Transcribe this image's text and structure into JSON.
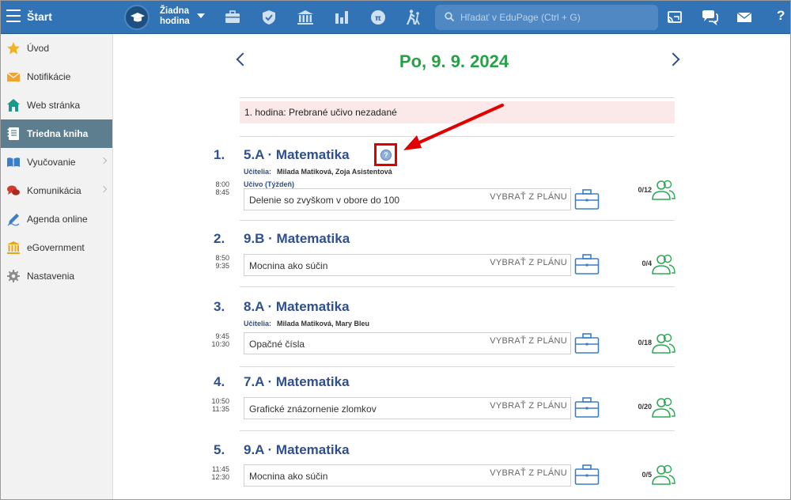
{
  "topbar": {
    "app_title": "Štart",
    "period_label_line1": "Žiadna",
    "period_label_line2": "hodina",
    "search_placeholder": "Hľadať v EduPage (Ctrl + G)",
    "help_label": "?",
    "icons": [
      "briefcase-icon",
      "shield-icon",
      "bank-icon",
      "bar-chart-icon",
      "pi-circle-icon",
      "hiking-icon",
      "cast-icon",
      "chat-icon",
      "mail-icon",
      "help-icon"
    ]
  },
  "sidebar": {
    "items": [
      {
        "label": "Úvod",
        "icon": "star-icon",
        "has_submenu": false,
        "active": false
      },
      {
        "label": "Notifikácie",
        "icon": "envelope-icon",
        "has_submenu": false,
        "active": false
      },
      {
        "label": "Web stránka",
        "icon": "house-icon",
        "has_submenu": false,
        "active": false
      },
      {
        "label": "Triedna kniha",
        "icon": "notebook-icon",
        "has_submenu": false,
        "active": true
      },
      {
        "label": "Vyučovanie",
        "icon": "open-book-icon",
        "has_submenu": true,
        "active": false
      },
      {
        "label": "Komunikácia",
        "icon": "speech-bubbles-icon",
        "has_submenu": true,
        "active": false
      },
      {
        "label": "Agenda online",
        "icon": "pencil-icon",
        "has_submenu": false,
        "active": false
      },
      {
        "label": "eGovernment",
        "icon": "bank-icon",
        "has_submenu": false,
        "active": false
      },
      {
        "label": "Nastavenia",
        "icon": "gear-icon",
        "has_submenu": false,
        "active": false
      }
    ]
  },
  "main": {
    "date": "Po, 9. 9. 2024",
    "notice": "1. hodina: Prebrané učivo nezadané",
    "help_marker": "?",
    "plan_label": "VYBRAŤ Z PLÁNU",
    "lessons": [
      {
        "num": "1.",
        "title": "5.A · Matematika",
        "teachers_label": "Učitelia:",
        "teachers": "Milada Matiková, Zoja Asistentová",
        "curriculum": "Učivo (Týždeň)",
        "start": "8:00",
        "end": "8:45",
        "topic": "Delenie so zvyškom v obore do 100",
        "count": "0/12"
      },
      {
        "num": "2.",
        "title": "9.B · Matematika",
        "start": "8:50",
        "end": "9:35",
        "topic": "Mocnina ako súčin",
        "count": "0/4"
      },
      {
        "num": "3.",
        "title": "8.A · Matematika",
        "teachers_label": "Učitelia:",
        "teachers": "Milada Matiková, Mary Bleu",
        "start": "9:45",
        "end": "10:30",
        "topic": "Opačné čísla",
        "count": "0/18"
      },
      {
        "num": "4.",
        "title": "7.A · Matematika",
        "start": "10:50",
        "end": "11:35",
        "topic": "Grafické znázornenie zlomkov",
        "count": "0/20"
      },
      {
        "num": "5.",
        "title": "9.A · Matematika",
        "start": "11:45",
        "end": "12:30",
        "topic": "Mocnina ako súčin",
        "count": "0/5"
      }
    ]
  },
  "colors": {
    "topbar": "#3273b5",
    "date_green": "#26a246",
    "title_blue": "#2f4f8f",
    "annotation_red": "#e00000",
    "sidebar_active": "#5d7e8f"
  }
}
